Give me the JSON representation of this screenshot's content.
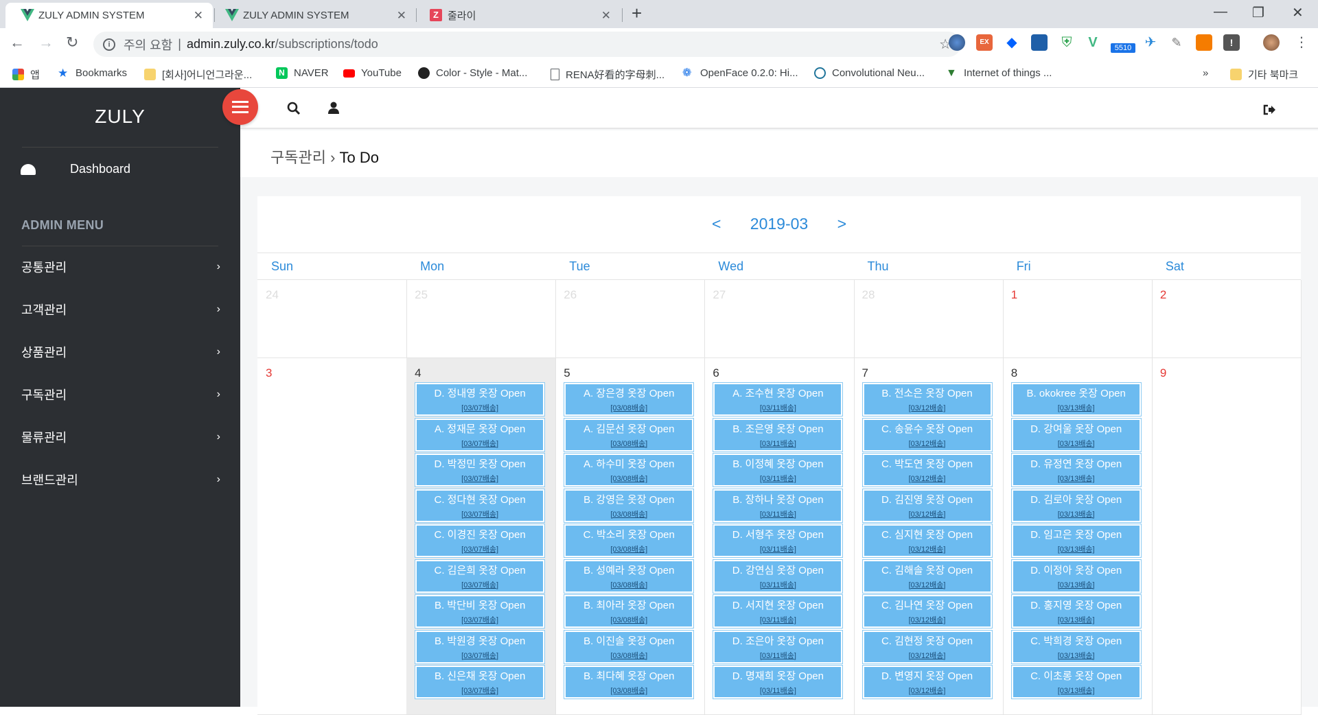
{
  "browser": {
    "tabs": [
      {
        "title": "ZULY ADMIN SYSTEM"
      },
      {
        "title": "ZULY ADMIN SYSTEM"
      },
      {
        "title": "줄라이"
      }
    ],
    "address": {
      "security_label": "주의 요함",
      "host": "admin.zuly.co.kr",
      "path": "/subscriptions/todo"
    },
    "bookmarks": [
      "앱",
      "Bookmarks",
      "[회사]어니언그라운...",
      "NAVER",
      "YouTube",
      "Color - Style - Mat...",
      "RENA好看的字母刺...",
      "OpenFace 0.2.0: Hi...",
      "Convolutional Neu...",
      "Internet of things ...",
      "»",
      "기타 북마크"
    ],
    "ext_badge": "5510"
  },
  "sidebar": {
    "logo": "ZULY",
    "dashboard": "Dashboard",
    "admin_menu": "ADMIN MENU",
    "items": [
      "공통관리",
      "고객관리",
      "상품관리",
      "구독관리",
      "물류관리",
      "브랜드관리"
    ]
  },
  "breadcrumb": {
    "parent": "구독관리",
    "sep": "›",
    "current": "To Do"
  },
  "calendar": {
    "prev": "<",
    "month": "2019-03",
    "next": ">",
    "weekdays": [
      "Sun",
      "Mon",
      "Tue",
      "Wed",
      "Thu",
      "Fri",
      "Sat"
    ],
    "week1": [
      "24",
      "25",
      "26",
      "27",
      "28",
      "1",
      "2"
    ],
    "week2": [
      "3",
      "4",
      "5",
      "6",
      "7",
      "8",
      "9"
    ],
    "events": {
      "mon": {
        "sub": "[03/07배송]",
        "items": [
          "D. 정내영 옷장 Open",
          "A. 정재문 옷장 Open",
          "D. 박정민 옷장 Open",
          "C. 정다현 옷장 Open",
          "C. 이경진 옷장 Open",
          "C. 김은희 옷장 Open",
          "B. 박단비 옷장 Open",
          "B. 박원경 옷장 Open",
          "B. 신은채 옷장 Open"
        ]
      },
      "tue": {
        "sub": "[03/08배송]",
        "items": [
          "A. 장은경 옷장 Open",
          "A. 김문선 옷장 Open",
          "A. 하수미 옷장 Open",
          "B. 강영은 옷장 Open",
          "C. 박소리 옷장 Open",
          "B. 성예라 옷장 Open",
          "B. 최아라 옷장 Open",
          "B. 이진솔 옷장 Open",
          "B. 최다혜 옷장 Open"
        ]
      },
      "wed": {
        "sub": "[03/11배송]",
        "items": [
          "A. 조수현 옷장 Open",
          "B. 조은영 옷장 Open",
          "B. 이정혜 옷장 Open",
          "B. 장하나 옷장 Open",
          "D. 서형주 옷장 Open",
          "D. 강연심 옷장 Open",
          "D. 서지현 옷장 Open",
          "D. 조은아 옷장 Open",
          "D. 명재희 옷장 Open"
        ]
      },
      "thu": {
        "sub": "[03/12배송]",
        "items": [
          "B. 전소은 옷장 Open",
          "C. 송윤수 옷장 Open",
          "C. 박도연 옷장 Open",
          "D. 김진영 옷장 Open",
          "C. 심지현 옷장 Open",
          "C. 김해솔 옷장 Open",
          "C. 김나연 옷장 Open",
          "C. 김현정 옷장 Open",
          "D. 변영지 옷장 Open"
        ]
      },
      "fri": {
        "sub": "[03/13배송]",
        "items": [
          "B. okokree 옷장 Open",
          "D. 강여울 옷장 Open",
          "D. 유정연 옷장 Open",
          "D. 김로아 옷장 Open",
          "D. 임고은 옷장 Open",
          "D. 이정아 옷장 Open",
          "D. 홍지영 옷장 Open",
          "C. 박희경 옷장 Open",
          "C. 이초롱 옷장 Open"
        ]
      }
    }
  }
}
